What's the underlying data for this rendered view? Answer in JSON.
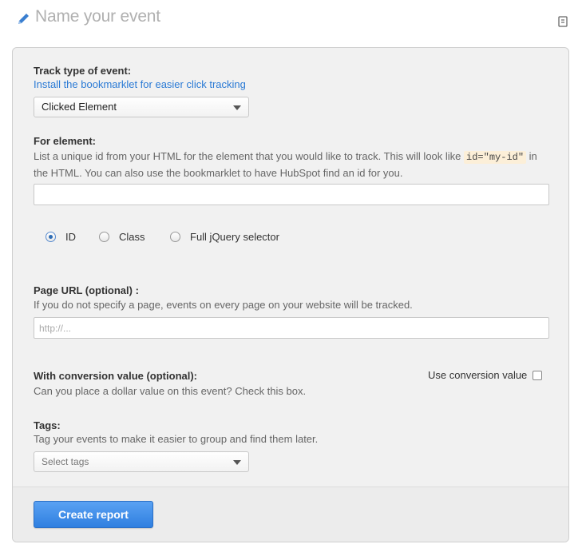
{
  "header": {
    "title": "Name your event",
    "edit_icon": "pencil-icon",
    "doc_icon": "document-icon"
  },
  "track_type": {
    "label": "Track type of event:",
    "link": "Install the bookmarklet for easier click tracking",
    "selected": "Clicked Element"
  },
  "element": {
    "label": "For element:",
    "help_part1": "List a unique id from your HTML for the element that you would like to track. This will look like",
    "code": "id=\"my-id\"",
    "help_part2": "in",
    "help_line2": "the HTML. You can also use the bookmarklet to have HubSpot find an id for you.",
    "value": "",
    "selector_options": [
      {
        "label": "ID",
        "checked": true
      },
      {
        "label": "Class",
        "checked": false
      },
      {
        "label": "Full jQuery selector",
        "checked": false
      }
    ]
  },
  "page_url": {
    "label": "Page URL (optional) :",
    "help": "If you do not specify a page, events on every page on your website will be tracked.",
    "placeholder": "http://..."
  },
  "conversion": {
    "label": "With conversion value (optional):",
    "help": "Can you place a dollar value on this event? Check this box.",
    "checkbox_label": "Use conversion value",
    "checked": false
  },
  "tags": {
    "label": "Tags:",
    "help": "Tag your events to make it easier to group and find them later.",
    "placeholder": "Select tags"
  },
  "footer": {
    "create_button": "Create report",
    "button_color": "#3a8ae6"
  }
}
